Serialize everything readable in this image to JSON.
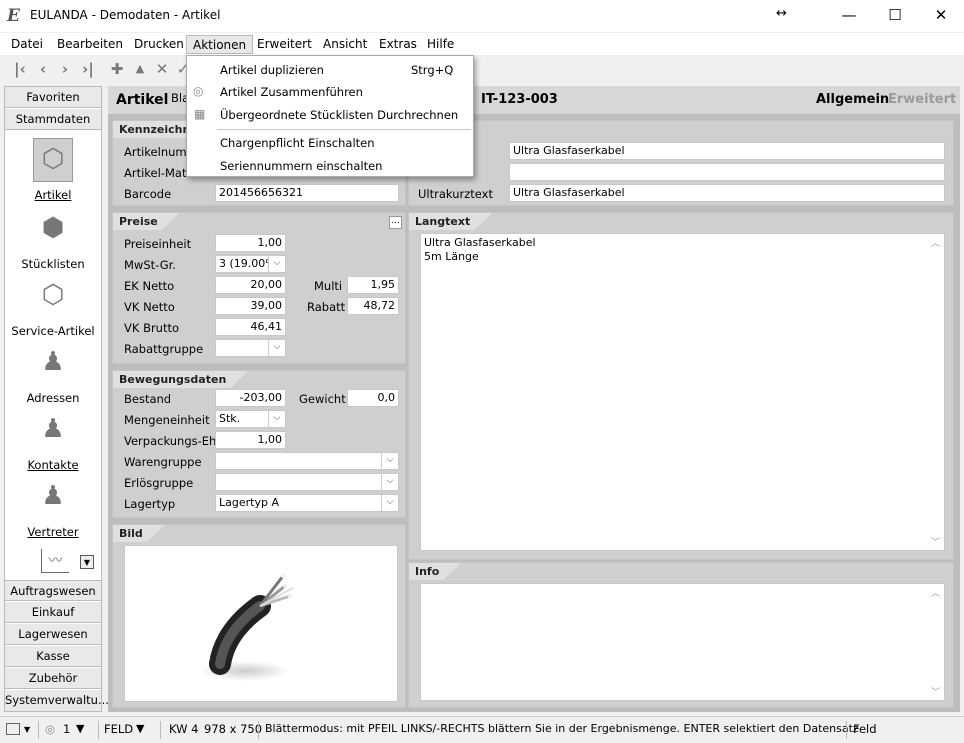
{
  "window": {
    "title": "EULANDA - Demodaten - Artikel",
    "logo_glyph": "E",
    "resize_glyph": "↔",
    "minimize_glyph": "—",
    "maximize_glyph": "☐",
    "close_glyph": "✕"
  },
  "menubar": [
    "Datei",
    "Bearbeiten",
    "Drucken",
    "Aktionen",
    "Erweitert",
    "Ansicht",
    "Extras",
    "Hilfe"
  ],
  "toolbar": [
    "first-icon",
    "prev-icon",
    "next-icon",
    "last-icon",
    "add-icon",
    "up-icon",
    "delete-icon",
    "confirm-icon"
  ],
  "aktionen_menu": {
    "items": [
      {
        "label": "Artikel duplizieren",
        "shortcut": "Strg+Q"
      },
      {
        "label": "Artikel Zusammenführen",
        "shortcut": ""
      },
      {
        "label": "Übergeordnete Stücklisten Durchrechnen",
        "shortcut": ""
      },
      {
        "label": "Chargenpflicht Einschalten",
        "shortcut": ""
      },
      {
        "label": "Seriennummern einschalten",
        "shortcut": ""
      }
    ]
  },
  "sidebar": {
    "top": [
      "Favoriten",
      "Stammdaten"
    ],
    "modules": [
      "Artikel",
      "Stücklisten",
      "Service-Artikel",
      "Adressen",
      "Kontakte",
      "Vertreter"
    ],
    "bottom": [
      "Auftragswesen",
      "Einkauf",
      "Lagerwesen",
      "Kasse",
      "Zubehör",
      "Systemverwaltu..."
    ]
  },
  "header": {
    "title": "Artikel",
    "subtitle": "Bla",
    "record": "IT-123-003",
    "tab_active": "Allgemein",
    "tab_inactive": "Erweitert"
  },
  "kennzeichnung": {
    "heading": "Kennzeichnung",
    "labels": [
      "Artikelnummer",
      "Artikel-Matchcode",
      "Barcode"
    ],
    "barcode": "201456656321",
    "right_labels": [
      "",
      "",
      "Ultrakurztext"
    ],
    "right_values": [
      "Ultra Glasfaserkabel",
      "",
      "Ultra Glasfaserkabel"
    ]
  },
  "preise": {
    "heading": "Preise",
    "more": "...",
    "preiseinheit": {
      "label": "Preiseinheit",
      "value": "1,00"
    },
    "mwst": {
      "label": "MwSt-Gr.",
      "value": "3 (19.00%)"
    },
    "ek": {
      "label": "EK Netto",
      "value": "20,00"
    },
    "multi": {
      "label": "Multi",
      "value": "1,95"
    },
    "vk": {
      "label": "VK Netto",
      "value": "39,00"
    },
    "rabatt": {
      "label": "Rabatt",
      "value": "48,72"
    },
    "brutto": {
      "label": "VK Brutto",
      "value": "46,41"
    },
    "rabattgruppe": {
      "label": "Rabattgruppe",
      "value": ""
    }
  },
  "bewegung": {
    "heading": "Bewegungsdaten",
    "bestand": {
      "label": "Bestand",
      "value": "-203,00"
    },
    "gewicht": {
      "label": "Gewicht",
      "value": "0,0"
    },
    "mengeneinheit": {
      "label": "Mengeneinheit",
      "value": "Stk."
    },
    "verpackung": {
      "label": "Verpackungs-Eh",
      "value": "1,00"
    },
    "warengruppe": {
      "label": "Warengruppe",
      "value": ""
    },
    "erloesgruppe": {
      "label": "Erlösgruppe",
      "value": ""
    },
    "lagertyp": {
      "label": "Lagertyp",
      "value": "Lagertyp A"
    }
  },
  "bild": {
    "heading": "Bild"
  },
  "langtext": {
    "heading": "Langtext",
    "line1": "Ultra Glasfaserkabel",
    "line2": "5m Länge"
  },
  "info": {
    "heading": "Info",
    "text": ""
  },
  "statusbar": {
    "count": "1",
    "mode": "FELD",
    "week": "KW 4",
    "size": "978 x 750",
    "message": "Blättermodus: mit PFEIL LINKS/-RECHTS blättern Sie in der Ergebnismenge. ENTER selektiert den Datensatz",
    "field": "Feld"
  }
}
